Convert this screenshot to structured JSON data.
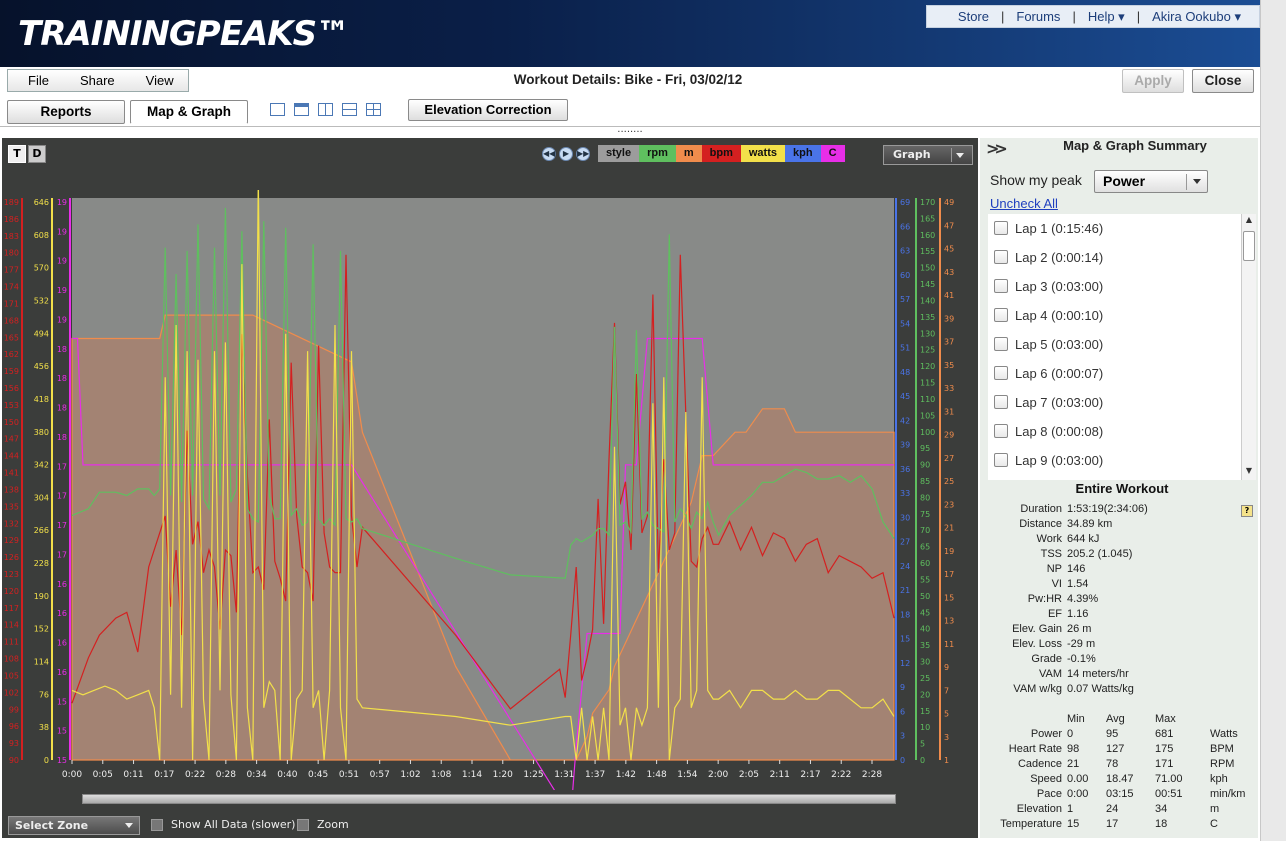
{
  "app": {
    "logo": "TRAININGPEAKS™"
  },
  "topnav": {
    "store": "Store",
    "forums": "Forums",
    "help": "Help ▾",
    "user": "Akira Ookubo ▾",
    "sep": "|"
  },
  "menu": {
    "file": "File",
    "share": "Share",
    "view": "View"
  },
  "window_title": "Workout Details: Bike - Fri, 03/02/12",
  "buttons": {
    "apply": "Apply",
    "close": "Close",
    "elevation": "Elevation Correction"
  },
  "tabs": {
    "reports": "Reports",
    "map_graph": "Map & Graph"
  },
  "graph": {
    "t_btn": "T",
    "d_btn": "D",
    "legend": [
      {
        "label": "style",
        "color": "#9c9c9c"
      },
      {
        "label": "rpm",
        "color": "#5fbf5f"
      },
      {
        "label": "m",
        "color": "#f08c4c"
      },
      {
        "label": "bpm",
        "color": "#d42020"
      },
      {
        "label": "watts",
        "color": "#f2e04a"
      },
      {
        "label": "kph",
        "color": "#4a74e8"
      },
      {
        "label": "C",
        "color": "#e82ee8"
      }
    ],
    "view_select": "Graph",
    "select_zone": "Select Zone",
    "show_all": "Show All Data (slower)",
    "zoom": "Zoom",
    "split": "........"
  },
  "chart_data": {
    "type": "line",
    "x_ticks": [
      "0:00",
      "0:05",
      "0:11",
      "0:17",
      "0:22",
      "0:28",
      "0:34",
      "0:40",
      "0:45",
      "0:51",
      "0:57",
      "1:02",
      "1:08",
      "1:14",
      "1:20",
      "1:25",
      "1:31",
      "1:37",
      "1:42",
      "1:48",
      "1:54",
      "2:00",
      "2:05",
      "2:11",
      "2:17",
      "2:22",
      "2:28"
    ],
    "axes": {
      "bpm": {
        "color": "#d42020",
        "ticks": [
          "189",
          "186",
          "183",
          "180",
          "177",
          "174",
          "171",
          "168",
          "165",
          "162",
          "159",
          "156",
          "153",
          "150",
          "147",
          "144",
          "141",
          "138",
          "135",
          "132",
          "129",
          "126",
          "123",
          "120",
          "117",
          "114",
          "111",
          "108",
          "105",
          "102",
          "99",
          "96",
          "93",
          "90"
        ]
      },
      "watts": {
        "color": "#f2e04a",
        "ticks": [
          "646",
          "608",
          "570",
          "532",
          "494",
          "456",
          "418",
          "380",
          "342",
          "304",
          "266",
          "228",
          "190",
          "152",
          "114",
          "76",
          "38",
          "0"
        ]
      },
      "temp": {
        "color": "#e82ee8",
        "ticks": [
          "19",
          "19",
          "19",
          "19",
          "19",
          "18",
          "18",
          "18",
          "18",
          "17",
          "17",
          "17",
          "17",
          "16",
          "16",
          "16",
          "16",
          "15",
          "15",
          "15"
        ]
      },
      "kph": {
        "color": "#4a74e8",
        "ticks": [
          "69",
          "66",
          "63",
          "60",
          "57",
          "54",
          "51",
          "48",
          "45",
          "42",
          "39",
          "36",
          "33",
          "30",
          "27",
          "24",
          "21",
          "18",
          "15",
          "12",
          "9",
          "6",
          "3",
          "0"
        ]
      },
      "rpm": {
        "color": "#5fbf5f",
        "ticks": [
          "170",
          "165",
          "160",
          "155",
          "150",
          "145",
          "140",
          "135",
          "130",
          "125",
          "120",
          "115",
          "110",
          "105",
          "100",
          "95",
          "90",
          "85",
          "80",
          "75",
          "70",
          "65",
          "60",
          "55",
          "50",
          "45",
          "40",
          "35",
          "30",
          "25",
          "20",
          "15",
          "10",
          "5",
          "0"
        ]
      },
      "m": {
        "color": "#f08c4c",
        "ticks": [
          "49",
          "47",
          "45",
          "43",
          "41",
          "39",
          "37",
          "35",
          "33",
          "31",
          "29",
          "27",
          "25",
          "23",
          "21",
          "19",
          "17",
          "15",
          "13",
          "11",
          "9",
          "7",
          "5",
          "3",
          "1"
        ]
      }
    },
    "series": [
      {
        "name": "m",
        "x": [
          0,
          16,
          17,
          32,
          33,
          51,
          53,
          70,
          80,
          91,
          92,
          94,
          95,
          98,
          99,
          101,
          103,
          105,
          107,
          109,
          111,
          113,
          114,
          115,
          117,
          121,
          123,
          126,
          130,
          132,
          150
        ],
        "y": [
          37,
          37,
          39,
          39,
          39,
          35,
          29,
          9,
          1,
          1,
          1,
          3,
          5,
          7,
          9,
          11,
          13,
          15,
          17,
          19,
          21,
          23,
          25,
          27,
          27,
          29,
          29,
          31,
          31,
          29,
          29
        ]
      },
      {
        "name": "C",
        "x": [
          0,
          1,
          2,
          51,
          91,
          92,
          94,
          100,
          101,
          102,
          103,
          105,
          108,
          111,
          115,
          117,
          133,
          135,
          150
        ],
        "y": [
          18.0,
          18.0,
          17.1,
          17.1,
          14.6,
          15.1,
          15.9,
          15.9,
          17.1,
          17.1,
          17.1,
          18.0,
          18.0,
          18.0,
          18.0,
          17.1,
          17.1,
          17.1,
          17.1
        ]
      },
      {
        "name": "bpm",
        "x": [
          0,
          3,
          5,
          8,
          10,
          12,
          14,
          16,
          17,
          18,
          19,
          20,
          21,
          22,
          23,
          24,
          25,
          26,
          27,
          28,
          29,
          30,
          31,
          32,
          33,
          34,
          35,
          36,
          37,
          38,
          39,
          40,
          41,
          42,
          43,
          44,
          45,
          46,
          47,
          48,
          49,
          50,
          51,
          52,
          53,
          70,
          80,
          89,
          90,
          91,
          92,
          93,
          94,
          95,
          96,
          97,
          98,
          99,
          100,
          101,
          102,
          103,
          104,
          105,
          106,
          107,
          108,
          109,
          110,
          111,
          112,
          113,
          114,
          115,
          116,
          117,
          118,
          120,
          122,
          124,
          126,
          128,
          130,
          132,
          134,
          136,
          138,
          140,
          142,
          144,
          146,
          148,
          150
        ],
        "y": [
          100,
          108,
          112,
          115,
          116,
          109,
          124,
          130,
          133,
          117,
          127,
          112,
          148,
          128,
          132,
          123,
          127,
          124,
          113,
          127,
          126,
          116,
          165,
          140,
          123,
          124,
          120,
          150,
          125,
          122,
          118,
          160,
          133,
          124,
          123,
          118,
          163,
          130,
          124,
          123,
          123,
          179,
          133,
          124,
          131,
          112,
          99,
          106,
          101,
          112,
          124,
          104,
          108,
          113,
          136,
          114,
          143,
          167,
          135,
          139,
          127,
          158,
          130,
          133,
          172,
          123,
          143,
          127,
          130,
          179,
          151,
          125,
          124,
          129,
          131,
          128,
          128,
          132,
          127,
          131,
          126,
          130,
          129,
          125,
          128,
          129,
          123,
          126,
          125,
          124,
          122,
          123,
          115
        ]
      },
      {
        "name": "rpm",
        "x": [
          0,
          3,
          5,
          8,
          10,
          12,
          14,
          15,
          16,
          17,
          18,
          19,
          20,
          21,
          22,
          23,
          24,
          25,
          26,
          27,
          28,
          29,
          30,
          31,
          32,
          33,
          34,
          35,
          36,
          37,
          38,
          39,
          40,
          41,
          42,
          43,
          44,
          45,
          46,
          47,
          48,
          49,
          50,
          51,
          52,
          53,
          70,
          80,
          90,
          91,
          92,
          93,
          94,
          95,
          96,
          97,
          98,
          99,
          100,
          101,
          102,
          103,
          104,
          105,
          106,
          107,
          108,
          109,
          110,
          111,
          112,
          113,
          114,
          115,
          116,
          117,
          118,
          120,
          122,
          124,
          126,
          128,
          130,
          132,
          134,
          136,
          138,
          140,
          142,
          144,
          146,
          148,
          150
        ],
        "y": [
          74,
          76,
          81,
          81,
          80,
          82,
          82,
          80,
          82,
          155,
          80,
          147,
          78,
          154,
          80,
          162,
          79,
          76,
          155,
          80,
          167,
          78,
          82,
          160,
          76,
          73,
          72,
          163,
          80,
          73,
          73,
          161,
          74,
          76,
          71,
          72,
          156,
          73,
          71,
          73,
          71,
          154,
          73,
          72,
          73,
          70,
          61,
          56,
          55,
          65,
          67,
          66,
          67,
          68,
          70,
          70,
          68,
          131,
          71,
          72,
          69,
          130,
          73,
          75,
          71,
          70,
          69,
          159,
          72,
          76,
          74,
          70,
          75,
          73,
          78,
          72,
          68,
          74,
          77,
          80,
          84,
          84,
          86,
          88,
          87,
          85,
          85,
          86,
          84,
          86,
          82,
          72,
          67
        ]
      },
      {
        "name": "watts",
        "x": [
          0,
          2,
          4,
          6,
          8,
          10,
          12,
          14,
          15,
          16,
          17,
          18,
          19,
          20,
          21,
          22,
          23,
          24,
          25,
          26,
          27,
          28,
          29,
          30,
          31,
          32,
          33,
          34,
          35,
          36,
          37,
          38,
          39,
          40,
          41,
          42,
          43,
          44,
          45,
          46,
          47,
          48,
          49,
          50,
          51,
          52,
          53,
          70,
          80,
          90,
          91,
          92,
          93,
          94,
          95,
          96,
          97,
          98,
          99,
          100,
          101,
          102,
          103,
          104,
          105,
          106,
          107,
          108,
          109,
          110,
          111,
          112,
          113,
          114,
          115,
          116,
          117,
          118,
          120,
          122,
          124,
          126,
          128,
          130,
          132,
          134,
          136,
          138,
          140,
          142,
          144,
          146,
          148,
          150
        ],
        "y": [
          80,
          75,
          80,
          85,
          80,
          70,
          75,
          80,
          60,
          0,
          440,
          75,
          500,
          60,
          470,
          0,
          460,
          70,
          0,
          470,
          80,
          480,
          75,
          0,
          570,
          60,
          0,
          670,
          60,
          90,
          80,
          0,
          490,
          0,
          70,
          80,
          470,
          60,
          80,
          0,
          80,
          500,
          60,
          0,
          470,
          70,
          60,
          50,
          40,
          50,
          50,
          0,
          60,
          0,
          50,
          0,
          60,
          0,
          360,
          40,
          60,
          0,
          60,
          40,
          60,
          410,
          60,
          440,
          0,
          60,
          70,
          400,
          60,
          80,
          440,
          80,
          70,
          70,
          80,
          60,
          80,
          80,
          70,
          70,
          80,
          70,
          70,
          80,
          80,
          70,
          60,
          60,
          70,
          50
        ]
      }
    ],
    "xlim": [
      0,
      150
    ]
  },
  "summary": {
    "title": "Map & Graph Summary",
    "peak_label": "Show my peak",
    "peak_value": "Power",
    "uncheck_all": "Uncheck All",
    "laps": [
      "Lap 1 (0:15:46)",
      "Lap 2 (0:00:14)",
      "Lap 3 (0:03:00)",
      "Lap 4 (0:00:10)",
      "Lap 5 (0:03:00)",
      "Lap 6 (0:00:07)",
      "Lap 7 (0:03:00)",
      "Lap 8 (0:00:08)",
      "Lap 9 (0:03:00)"
    ],
    "entire_title": "Entire Workout",
    "help": "?",
    "stats": [
      {
        "k": "Duration",
        "v": "1:53:19(2:34:06)"
      },
      {
        "k": "Distance",
        "v": "34.89 km"
      },
      {
        "k": "Work",
        "v": "644 kJ"
      },
      {
        "k": "TSS",
        "v": "205.2 (1.045)"
      },
      {
        "k": "NP",
        "v": "146"
      },
      {
        "k": "VI",
        "v": "1.54"
      },
      {
        "k": "Pw:HR",
        "v": "4.39%"
      },
      {
        "k": "EF",
        "v": "1.16"
      },
      {
        "k": "Elev. Gain",
        "v": "26 m"
      },
      {
        "k": "Elev. Loss",
        "v": "-29 m"
      },
      {
        "k": "Grade",
        "v": "-0.1%"
      },
      {
        "k": "VAM",
        "v": "14 meters/hr"
      },
      {
        "k": "VAM w/kg",
        "v": "0.07 Watts/kg"
      }
    ],
    "minmax_headers": [
      "Min",
      "Avg",
      "Max"
    ],
    "minmax": [
      {
        "k": "Power",
        "min": "0",
        "avg": "95",
        "max": "681",
        "u": "Watts"
      },
      {
        "k": "Heart Rate",
        "min": "98",
        "avg": "127",
        "max": "175",
        "u": "BPM"
      },
      {
        "k": "Cadence",
        "min": "21",
        "avg": "78",
        "max": "171",
        "u": "RPM"
      },
      {
        "k": "Speed",
        "min": "0.00",
        "avg": "18.47",
        "max": "71.00",
        "u": "kph"
      },
      {
        "k": "Pace",
        "min": "0:00",
        "avg": "03:15",
        "max": "00:51",
        "u": "min/km"
      },
      {
        "k": "Elevation",
        "min": "1",
        "avg": "24",
        "max": "34",
        "u": "m"
      },
      {
        "k": "Temperature",
        "min": "15",
        "avg": "17",
        "max": "18",
        "u": "C"
      }
    ]
  }
}
